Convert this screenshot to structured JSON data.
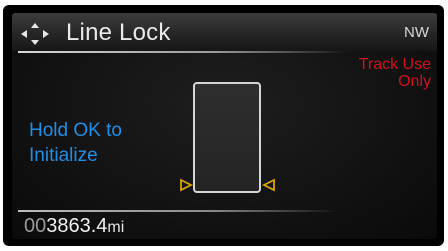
{
  "header": {
    "title": "Line Lock",
    "compass": "NW",
    "nav_icon": "four-way-arrows-icon"
  },
  "warning": {
    "line1": "Track Use",
    "line2": "Only",
    "color": "#d0101c"
  },
  "main": {
    "prompt_line1": "Hold OK to",
    "prompt_line2": "Initialize",
    "prompt_color": "#1f8fe6",
    "marker_color": "#d9a300"
  },
  "footer": {
    "odometer_lead": "00",
    "odometer_value": "3863.4",
    "odometer_unit": "mi"
  }
}
